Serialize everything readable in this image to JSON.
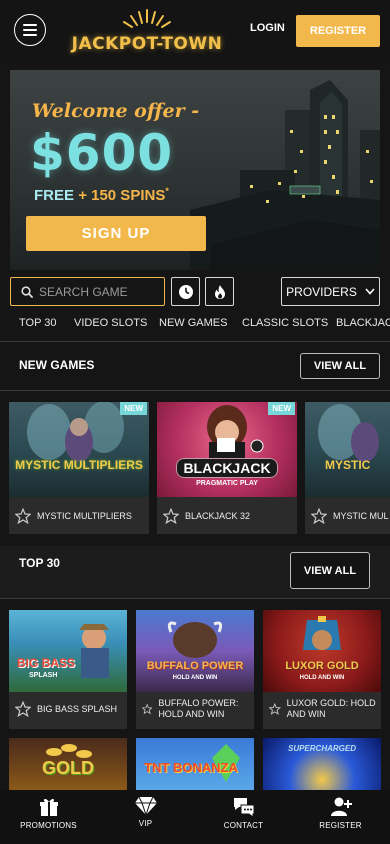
{
  "header": {
    "logo_text": "JACKPOT-TOWN",
    "login_label": "LOGIN",
    "register_label": "REGISTER"
  },
  "banner": {
    "welcome": "Welcome offer -",
    "amount": "$600",
    "spins_free": "FREE",
    "spins_rest": "+ 150 SPINS",
    "spins_mark": "*",
    "signup_label": "SIGN UP"
  },
  "search": {
    "placeholder": "SEARCH GAME",
    "providers_label": "PROVIDERS"
  },
  "tabs": [
    "TOP 30",
    "VIDEO SLOTS",
    "NEW GAMES",
    "CLASSIC SLOTS",
    "BLACKJACK"
  ],
  "new_games": {
    "title": "NEW GAMES",
    "view_all": "VIEW ALL",
    "badge": "NEW",
    "cards": [
      {
        "name": "MYSTIC MULTIPLIERS",
        "art": "MYSTIC MULTIPLIERS"
      },
      {
        "name": "BLACKJACK 32",
        "art": "BLACKJACK",
        "art_sub": "PRAGMATIC PLAY"
      },
      {
        "name": "MYSTIC MUL",
        "art": "MYSTIC"
      }
    ]
  },
  "top30": {
    "title": "TOP 30",
    "view_all": "VIEW ALL",
    "cards": [
      {
        "name": "BIG BASS SPLASH",
        "art": "BIG BASS",
        "art_sub": "SPLASH"
      },
      {
        "name": "BUFFALO POWER: HOLD AND WIN",
        "art": "BUFFALO POWER",
        "art_sub": "HOLD AND WIN"
      },
      {
        "name": "LUXOR GOLD: HOLD AND WIN",
        "art": "LUXOR GOLD",
        "art_sub": "HOLD AND WIN"
      }
    ],
    "row2": [
      {
        "art": "GOLD"
      },
      {
        "art": "TNT BONANZA"
      },
      {
        "art": "SUPERCHARGED"
      }
    ]
  },
  "bottom_nav": [
    "PROMOTIONS",
    "VIP",
    "CONTACT",
    "REGISTER"
  ],
  "colors": {
    "accent": "#f2b84b",
    "teal": "#76d6d8",
    "background": "#151515"
  }
}
